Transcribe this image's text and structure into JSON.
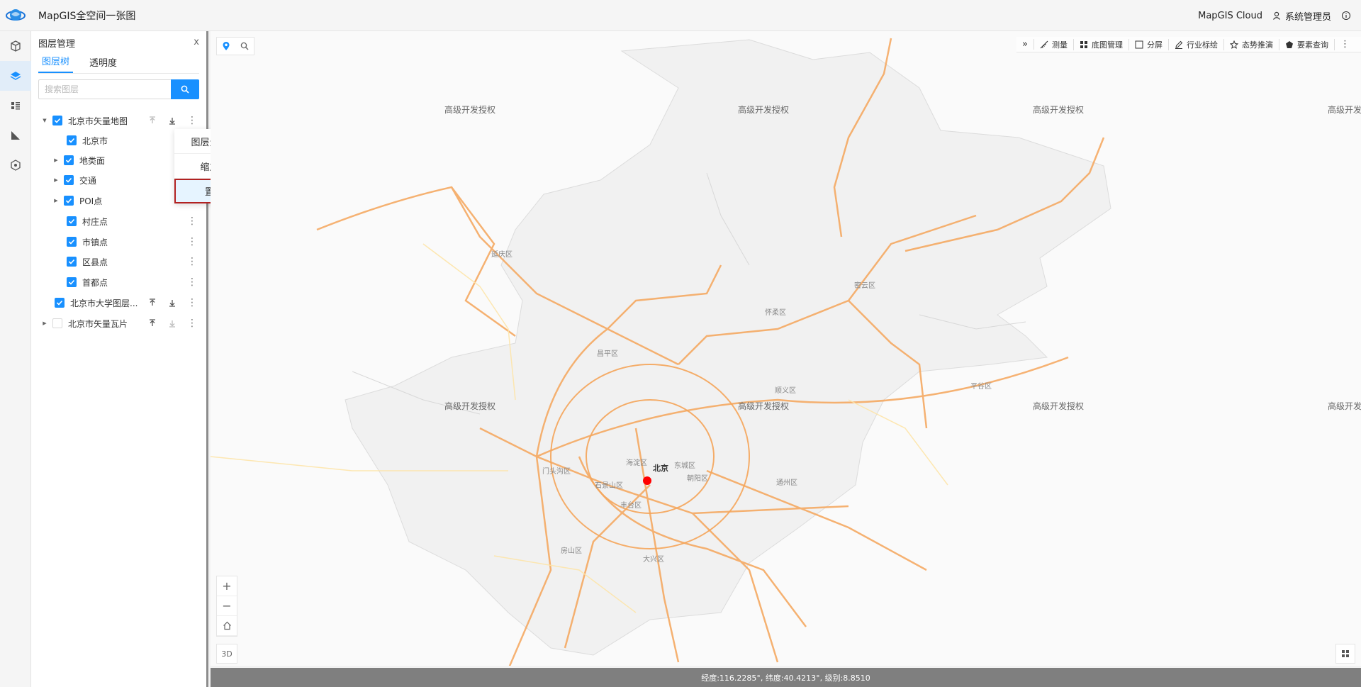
{
  "app": {
    "title": "MapGIS全空间一张图",
    "cloud_label": "MapGIS Cloud",
    "user": "系统管理员"
  },
  "panel": {
    "title": "图层管理",
    "close": "x",
    "tabs": [
      {
        "label": "图层树"
      },
      {
        "label": "透明度"
      }
    ],
    "search_placeholder": "搜索图层"
  },
  "tree": [
    {
      "label": "北京市矢量地图",
      "checked": true,
      "level": 0,
      "expanded": true
    },
    {
      "label": "北京市",
      "checked": true,
      "level": 1
    },
    {
      "label": "地类面",
      "checked": true,
      "level": 1,
      "collapsed": true
    },
    {
      "label": "交通",
      "checked": true,
      "level": 1,
      "collapsed": true
    },
    {
      "label": "POI点",
      "checked": true,
      "level": 1,
      "collapsed": true
    },
    {
      "label": "村庄点",
      "checked": true,
      "level": 1
    },
    {
      "label": "市镇点",
      "checked": true,
      "level": 1
    },
    {
      "label": "区县点",
      "checked": true,
      "level": 1
    },
    {
      "label": "首都点",
      "checked": true,
      "level": 1
    },
    {
      "label": "北京市大学图层...",
      "checked": true,
      "level": 0
    },
    {
      "label": "北京市矢量瓦片",
      "checked": false,
      "level": 0,
      "collapsed": true
    }
  ],
  "context_menu": [
    {
      "label": "图层元数据"
    },
    {
      "label": "缩放至"
    },
    {
      "label": "置顶"
    }
  ],
  "map_toolbar": [
    {
      "label": "»"
    },
    {
      "label": "测量"
    },
    {
      "label": "底图管理"
    },
    {
      "label": "分屏"
    },
    {
      "label": "行业标绘"
    },
    {
      "label": "态势推演"
    },
    {
      "label": "要素查询"
    }
  ],
  "watermark": "高级开发授权",
  "districts": {
    "yanqing": "延庆区",
    "miyun": "密云区",
    "huairou": "怀柔区",
    "changping": "昌平区",
    "shunyi": "顺义区",
    "pinggu": "平谷区",
    "mentougou": "门头沟区",
    "haidian": "海淀区",
    "beijing": "北京",
    "dongcheng": "东城区",
    "shijingshan": "石景山区",
    "chaoyang": "朝阳区",
    "tongzhou": "通州区",
    "fengtai": "丰台区",
    "fangshan": "房山区",
    "daxing": "大兴区"
  },
  "zoom": {
    "in": "+",
    "out": "−",
    "mode_3d": "3D"
  },
  "status": "经度:116.2285°, 纬度:40.4213°, 级别:8.8510"
}
